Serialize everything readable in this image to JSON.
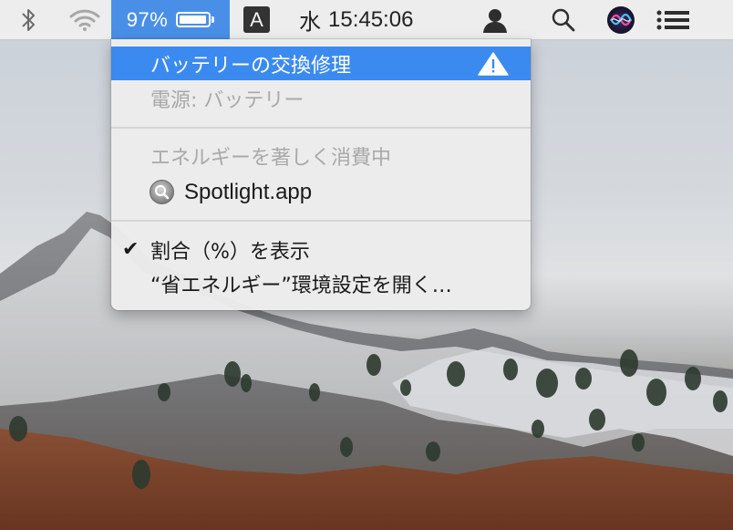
{
  "menubar": {
    "battery_percent": "97%",
    "battery_level": 0.97,
    "input_source": "A",
    "clock_day": "水",
    "clock_time": "15:45:06",
    "icons": [
      "bluetooth-icon",
      "wifi-icon",
      "user-icon",
      "spotlight-search-icon",
      "siri-icon",
      "notification-center-icon"
    ]
  },
  "battery_menu": {
    "service_label": "バッテリーの交換修理",
    "power_source": "電源: バッテリー",
    "energy_header": "エネルギーを著しく消費中",
    "apps": [
      {
        "name": "Spotlight.app",
        "icon": "spotlight-app-icon"
      }
    ],
    "show_percent_label": "割合（%）を表示",
    "show_percent_checked": true,
    "energy_saver_label": "“省エネルギー”環境設定を開く…"
  },
  "colors": {
    "highlight": "#3b8af0",
    "battery_active_bg": "#4a8fe7",
    "menubar_bg": "#eeeeee"
  }
}
